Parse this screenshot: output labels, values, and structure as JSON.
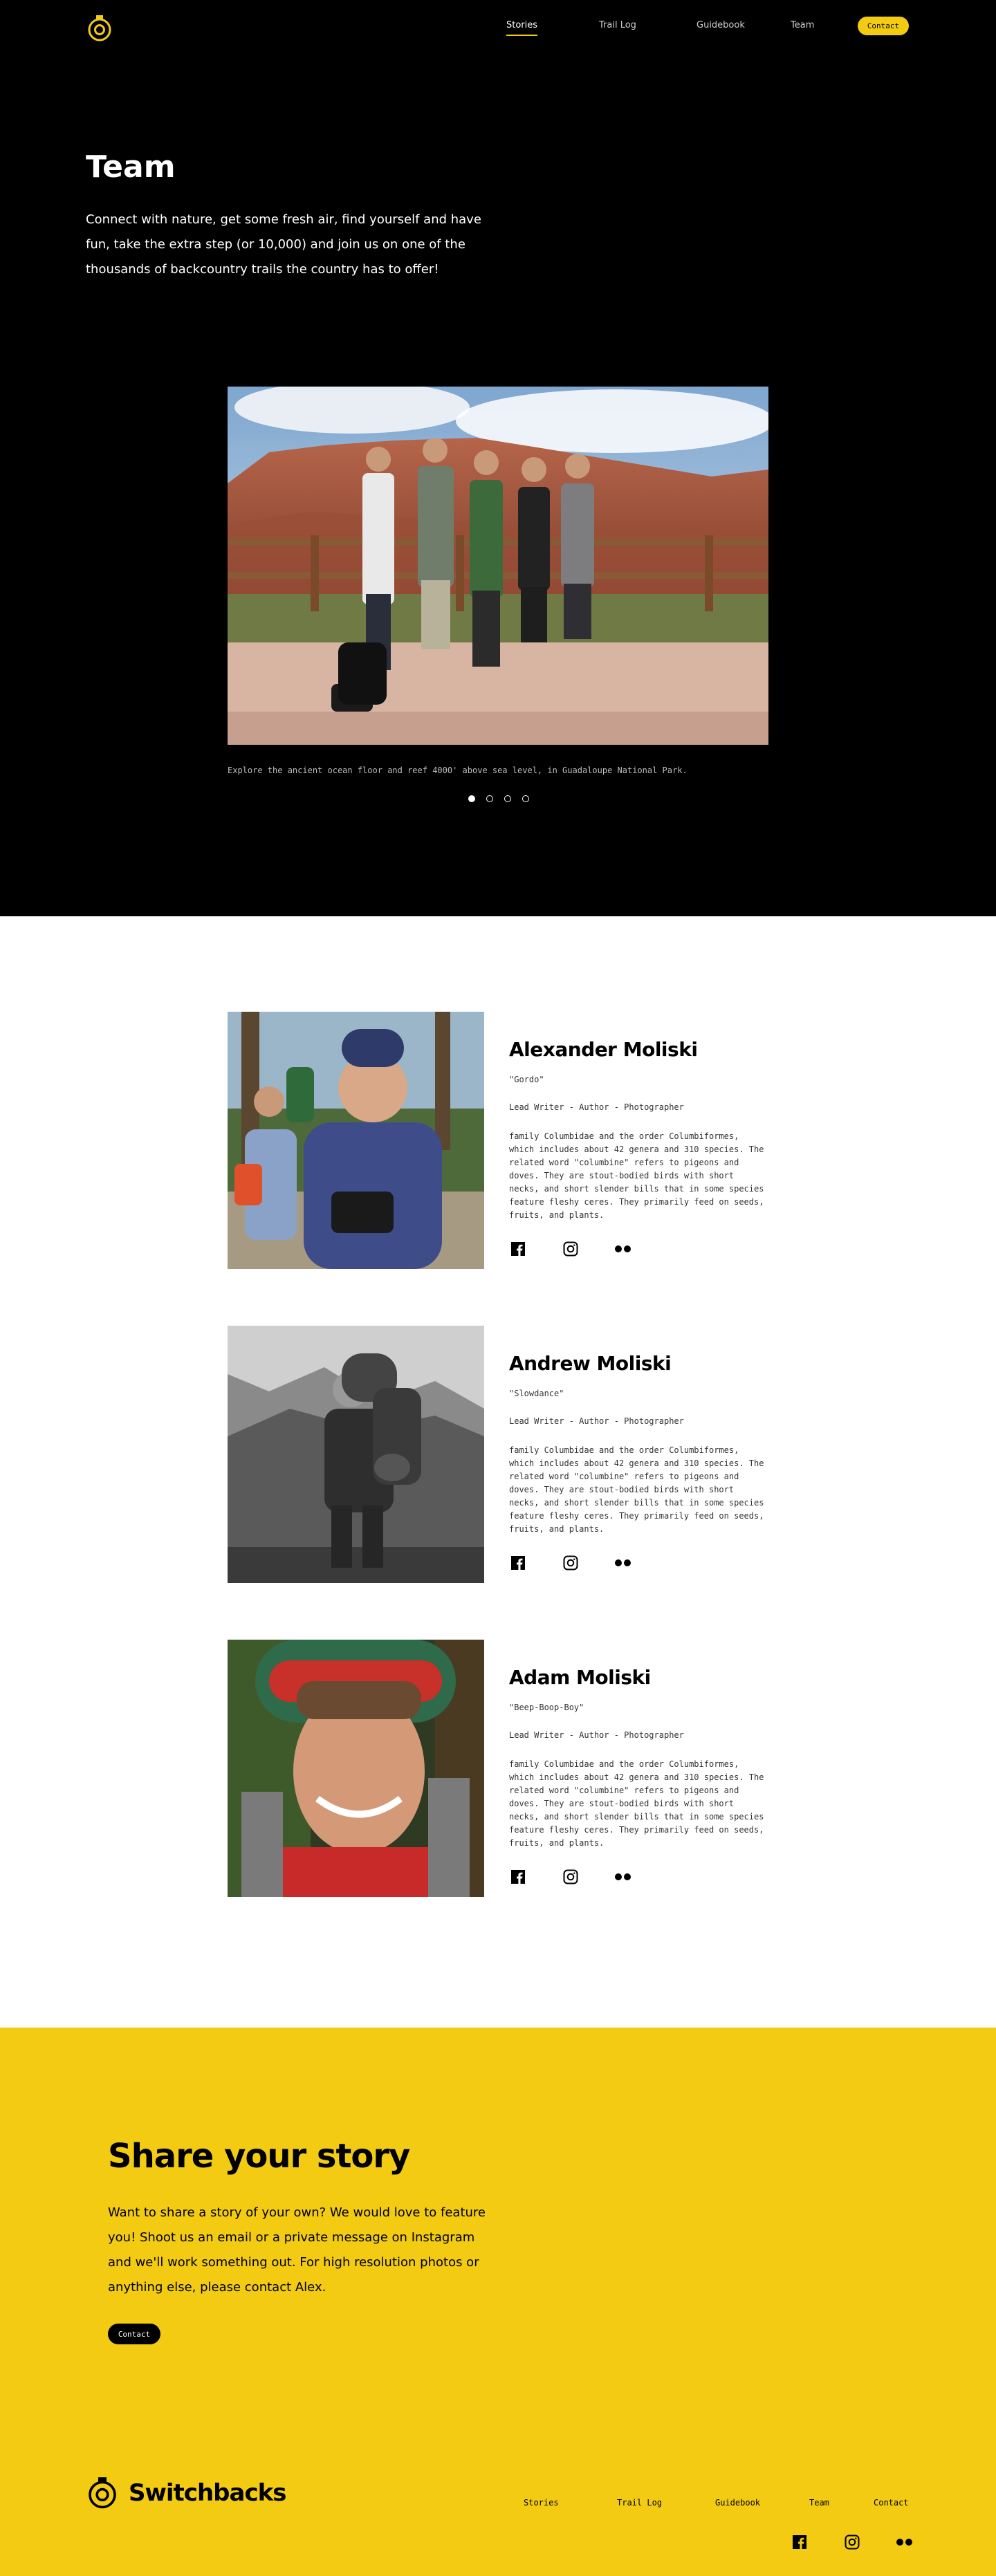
{
  "nav": {
    "items": [
      {
        "label": "Stories",
        "active": true
      },
      {
        "label": "Trail Log",
        "active": false
      },
      {
        "label": "Guidebook",
        "active": false
      },
      {
        "label": "Team",
        "active": false
      }
    ],
    "contact_label": "Contact"
  },
  "hero": {
    "title": "Team",
    "intro": "Connect with nature, get some fresh air, find yourself and have fun, take the extra step (or 10,000) and join us on one of the thousands of backcountry trails the country has to offer!",
    "caption": "Explore the ancient ocean floor and reef 4000' above sea level, in Guadaloupe National Park.",
    "slide_count": 4,
    "active_slide": 1
  },
  "team": {
    "members": [
      {
        "name": "Alexander Moliski",
        "nickname": "\"Gordo\"",
        "role": "Lead Writer - Author - Photographer",
        "bio": "family Columbidae and the order Columbiformes, which includes about 42 genera and 310 species. The related word \"columbine\" refers to pigeons and doves. They are stout-bodied birds with short necks, and short slender bills that in some species feature fleshy ceres. They primarily feed on seeds, fruits, and plants."
      },
      {
        "name": "Andrew Moliski",
        "nickname": "\"Slowdance\"",
        "role": "Lead Writer - Author - Photographer",
        "bio": "family Columbidae and the order Columbiformes, which includes about 42 genera and 310 species. The related word \"columbine\" refers to pigeons and doves. They are stout-bodied birds with short necks, and short slender bills that in some species feature fleshy ceres. They primarily feed on seeds, fruits, and plants."
      },
      {
        "name": "Adam Moliski",
        "nickname": "\"Beep-Boop-Boy\"",
        "role": "Lead Writer - Author - Photographer",
        "bio": "family Columbidae and the order Columbiformes, which includes about 42 genera and 310 species. The related word \"columbine\" refers to pigeons and doves. They are stout-bodied birds with short necks, and short slender bills that in some species feature fleshy ceres. They primarily feed on seeds, fruits, and plants."
      }
    ]
  },
  "share": {
    "title": "Share your story",
    "text": "Want to share a story of your own? We would love to feature you! Shoot us an email or a private message on Instagram and we'll work something out. For high resolution photos or anything else, please contact Alex.",
    "button_label": "Contact"
  },
  "footer": {
    "brand": "Switchbacks",
    "nav": [
      "Stories",
      "Trail Log",
      "Guidebook",
      "Team",
      "Contact"
    ]
  },
  "colors": {
    "accent": "#f2cb12",
    "dark": "#000000",
    "light": "#ffffff"
  },
  "icons": [
    "logo-mark-icon",
    "facebook-icon",
    "instagram-icon",
    "flickr-icon"
  ]
}
